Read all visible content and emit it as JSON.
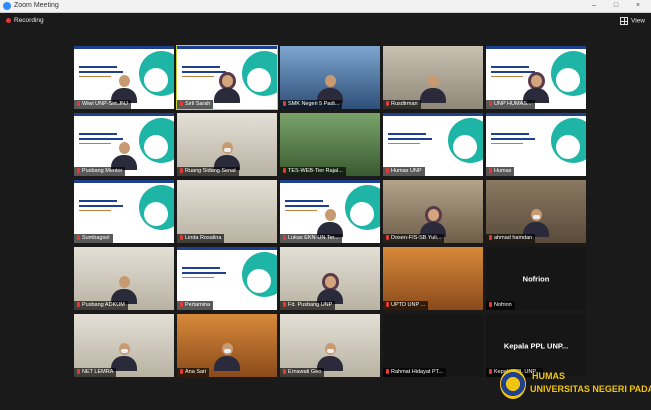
{
  "window": {
    "title": "Zoom Meeting",
    "minimize": "–",
    "maximize": "□",
    "close": "×"
  },
  "toolbar": {
    "recording_label": "Recording",
    "view_label": "View"
  },
  "participants": [
    {
      "name": "Wiwi UNP-Sirt.JNJ",
      "bg": "slide",
      "person": "plain"
    },
    {
      "name": "Sirli Sarah",
      "bg": "slide",
      "person": "hijab",
      "active": true
    },
    {
      "name": "SMK Negeri 5 Padi...",
      "bg": "cam-blue",
      "person": "plain"
    },
    {
      "name": "Rusdirman",
      "bg": "cam-office",
      "person": "plain"
    },
    {
      "name": "UNP HUMAS...",
      "bg": "slide",
      "person": "hijab"
    },
    {
      "name": "Pusbang Mentor",
      "bg": "slide",
      "person": "plain"
    },
    {
      "name": "Ruang Sidang Senat",
      "bg": "cam-light",
      "person": "mask"
    },
    {
      "name": "TES-WEB-Tier Rajal...",
      "bg": "cam-green",
      "person": "none"
    },
    {
      "name": "Humas UNP",
      "bg": "slide",
      "person": "none"
    },
    {
      "name": "Humas",
      "bg": "slide",
      "person": "none"
    },
    {
      "name": "Sumbagsel",
      "bg": "slide",
      "person": "none"
    },
    {
      "name": "Linda Rosalina",
      "bg": "cam-light",
      "person": "none"
    },
    {
      "name": "Lukas EKN-UN Ter...",
      "bg": "slide",
      "person": "plain"
    },
    {
      "name": "Dosen-FIS-SB Yuli...",
      "bg": "cam-room",
      "person": "hijab"
    },
    {
      "name": "ahmad hamdan",
      "bg": "cam-warm",
      "person": "mask"
    },
    {
      "name": "Pusbang ADKUM",
      "bg": "cam-light",
      "person": "plain"
    },
    {
      "name": "Pertamina",
      "bg": "slide",
      "person": "none"
    },
    {
      "name": "Fd. Pusbang UNP",
      "bg": "cam-light",
      "person": "hijab"
    },
    {
      "name": "UPTD UNP ...",
      "bg": "cam-orange",
      "person": "none"
    },
    {
      "name": "Nofrion",
      "bg": "cam-dark",
      "person": "text"
    },
    {
      "name": "NET LEMRA",
      "bg": "cam-light",
      "person": "mask"
    },
    {
      "name": "Ana Sari",
      "bg": "cam-orange",
      "person": "mask"
    },
    {
      "name": "Ernawati Geo",
      "bg": "cam-light",
      "person": "mask"
    },
    {
      "name": "Rahmat Hidayat PT...",
      "bg": "cam-dark",
      "person": "none"
    },
    {
      "name": "Kepala PPL UNP...",
      "bg": "cam-dark",
      "person": "text"
    }
  ],
  "watermark": {
    "line1": "HUMAS",
    "line2": "UNIVERSITAS NEGERI PADANG"
  },
  "colors": {
    "accent": "#2d8cff",
    "recording": "#e53935",
    "active_speaker": "#c9d33a",
    "watermark": "#f1c40f"
  }
}
